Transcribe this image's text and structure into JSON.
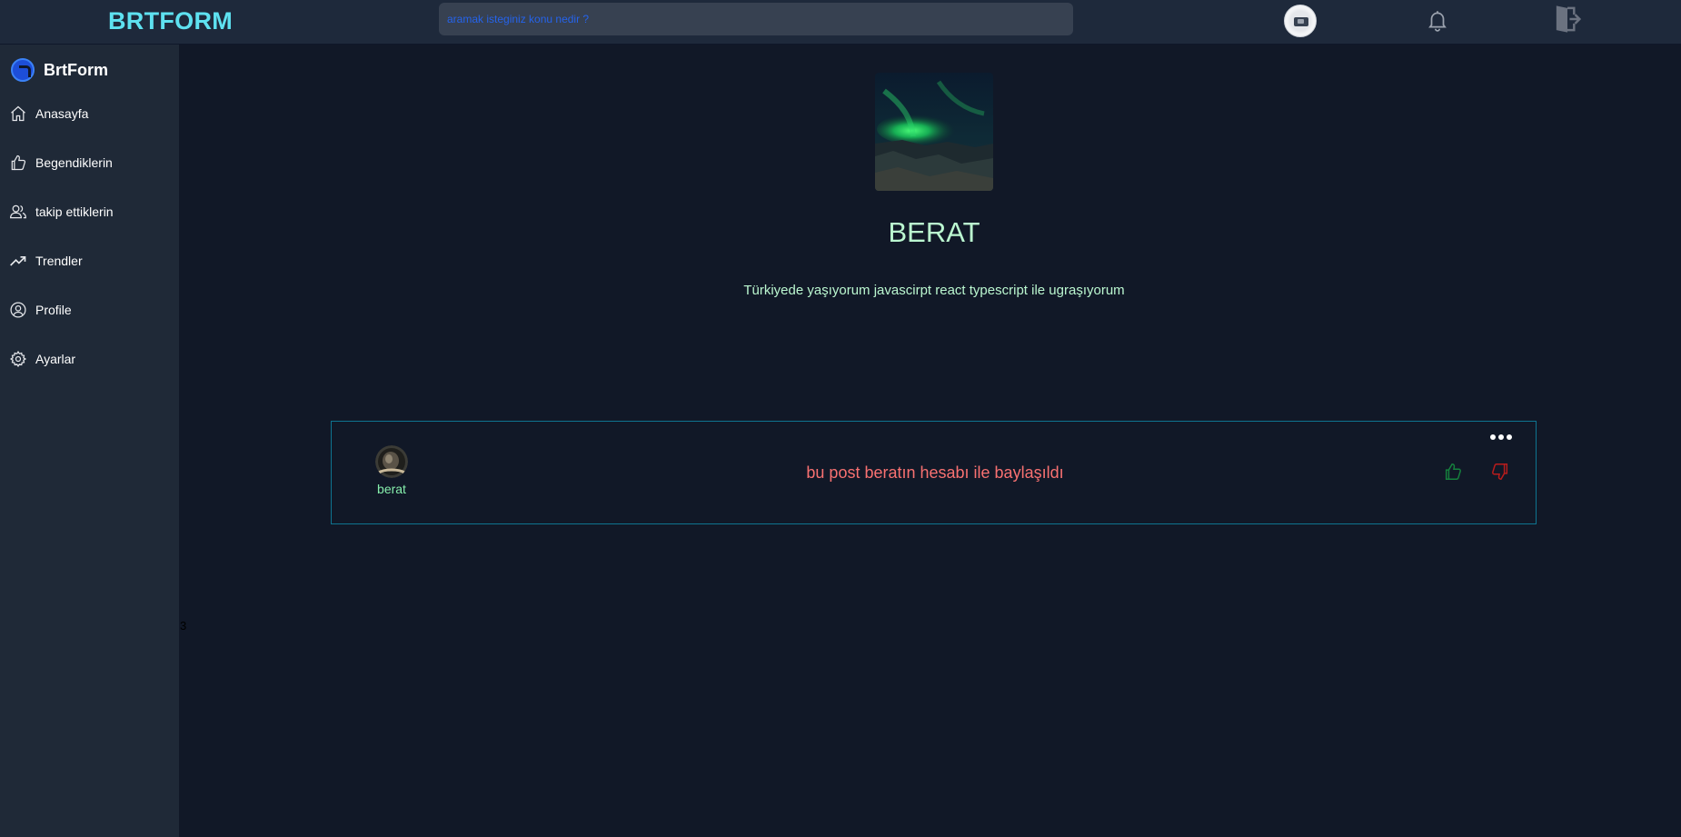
{
  "app": {
    "brand": "BRTFORM"
  },
  "header": {
    "search_placeholder": "aramak isteginiz konu nedir ?"
  },
  "sidebar": {
    "brand": "BrtForm",
    "items": [
      {
        "label": "Anasayfa",
        "icon": "home-icon"
      },
      {
        "label": "Begendiklerin",
        "icon": "thumbs-up-icon"
      },
      {
        "label": "takip ettiklerin",
        "icon": "users-icon"
      },
      {
        "label": "Trendler",
        "icon": "trending-icon"
      },
      {
        "label": "Profile",
        "icon": "user-circle-icon"
      },
      {
        "label": "Ayarlar",
        "icon": "gear-icon"
      }
    ]
  },
  "stray_text": "3",
  "profile": {
    "name": "BERAT",
    "bio": "Türkiyede yaşıyorum javascirpt react typescript ile ugraşıyorum"
  },
  "post": {
    "username": "berat",
    "text": "bu post beratın hesabı ile baylaşıldı"
  },
  "colors": {
    "background": "#111827",
    "sidebar": "#1f2937",
    "brand": "#5ee1f0",
    "name": "#bbf7d0",
    "post_text": "#f87171",
    "post_border": "#0e7490",
    "like": "#15803d",
    "dislike": "#b91c1c"
  }
}
